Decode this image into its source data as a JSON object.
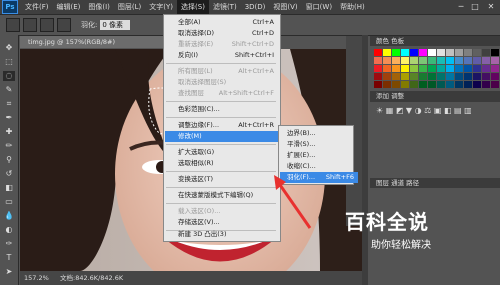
{
  "app": {
    "logo": "Ps"
  },
  "menubar": {
    "items": [
      "文件(F)",
      "编辑(E)",
      "图像(I)",
      "图层(L)",
      "文字(Y)",
      "选择(S)",
      "滤镜(T)",
      "3D(D)",
      "视图(V)",
      "窗口(W)",
      "帮助(H)"
    ],
    "active_index": 5
  },
  "window_controls": {
    "minimize": "─",
    "maximize": "□",
    "close": "✕"
  },
  "options_bar": {
    "feather_label": "羽化:",
    "feather_value": "0 像素"
  },
  "document": {
    "tab_title": "timg.jpg @ 157%(RGB/8#)",
    "zoom": "157.2%",
    "doc_info": "文档:842.6K/842.6K"
  },
  "panels": {
    "color_tabs": "颜色  色板",
    "adjust_title": "添加 调整",
    "layers_tabs": "图层  通道  路径"
  },
  "select_menu": {
    "items": [
      {
        "label": "全部(A)",
        "shortcut": "Ctrl+A",
        "disabled": false
      },
      {
        "label": "取消选择(D)",
        "shortcut": "Ctrl+D",
        "disabled": false
      },
      {
        "label": "重新选择(E)",
        "shortcut": "Shift+Ctrl+D",
        "disabled": true
      },
      {
        "label": "反向(I)",
        "shortcut": "Shift+Ctrl+I",
        "disabled": false
      },
      {
        "label": "所有图层(L)",
        "shortcut": "Alt+Ctrl+A",
        "disabled": true
      },
      {
        "label": "取消选择图层(S)",
        "shortcut": "",
        "disabled": true
      },
      {
        "label": "查找图层",
        "shortcut": "Alt+Shift+Ctrl+F",
        "disabled": true
      },
      {
        "label": "色彩范围(C)...",
        "shortcut": "",
        "disabled": false
      },
      {
        "label": "调整边缘(F)...",
        "shortcut": "Alt+Ctrl+R",
        "disabled": false
      },
      {
        "label": "修改(M)",
        "shortcut": "",
        "disabled": false,
        "highlighted": true
      },
      {
        "label": "扩大选取(G)",
        "shortcut": "",
        "disabled": false
      },
      {
        "label": "选取相似(R)",
        "shortcut": "",
        "disabled": false
      },
      {
        "label": "变换选区(T)",
        "shortcut": "",
        "disabled": false
      },
      {
        "label": "在快速蒙版模式下编辑(Q)",
        "shortcut": "",
        "disabled": false
      },
      {
        "label": "载入选区(O)...",
        "shortcut": "",
        "disabled": true
      },
      {
        "label": "存储选区(V)...",
        "shortcut": "",
        "disabled": false
      },
      {
        "label": "新建 3D 凸出(3)",
        "shortcut": "",
        "disabled": false
      }
    ]
  },
  "modify_submenu": {
    "items": [
      {
        "label": "边界(B)...",
        "shortcut": ""
      },
      {
        "label": "平滑(S)...",
        "shortcut": ""
      },
      {
        "label": "扩展(E)...",
        "shortcut": ""
      },
      {
        "label": "收缩(C)...",
        "shortcut": ""
      },
      {
        "label": "羽化(F)...",
        "shortcut": "Shift+F6",
        "highlighted": true
      }
    ]
  },
  "watermark": {
    "title": "百科全说",
    "subtitle": "助你轻松解决"
  },
  "colors": {
    "menu_highlight": "#3b8ae6",
    "arrow": "#e8312f"
  }
}
